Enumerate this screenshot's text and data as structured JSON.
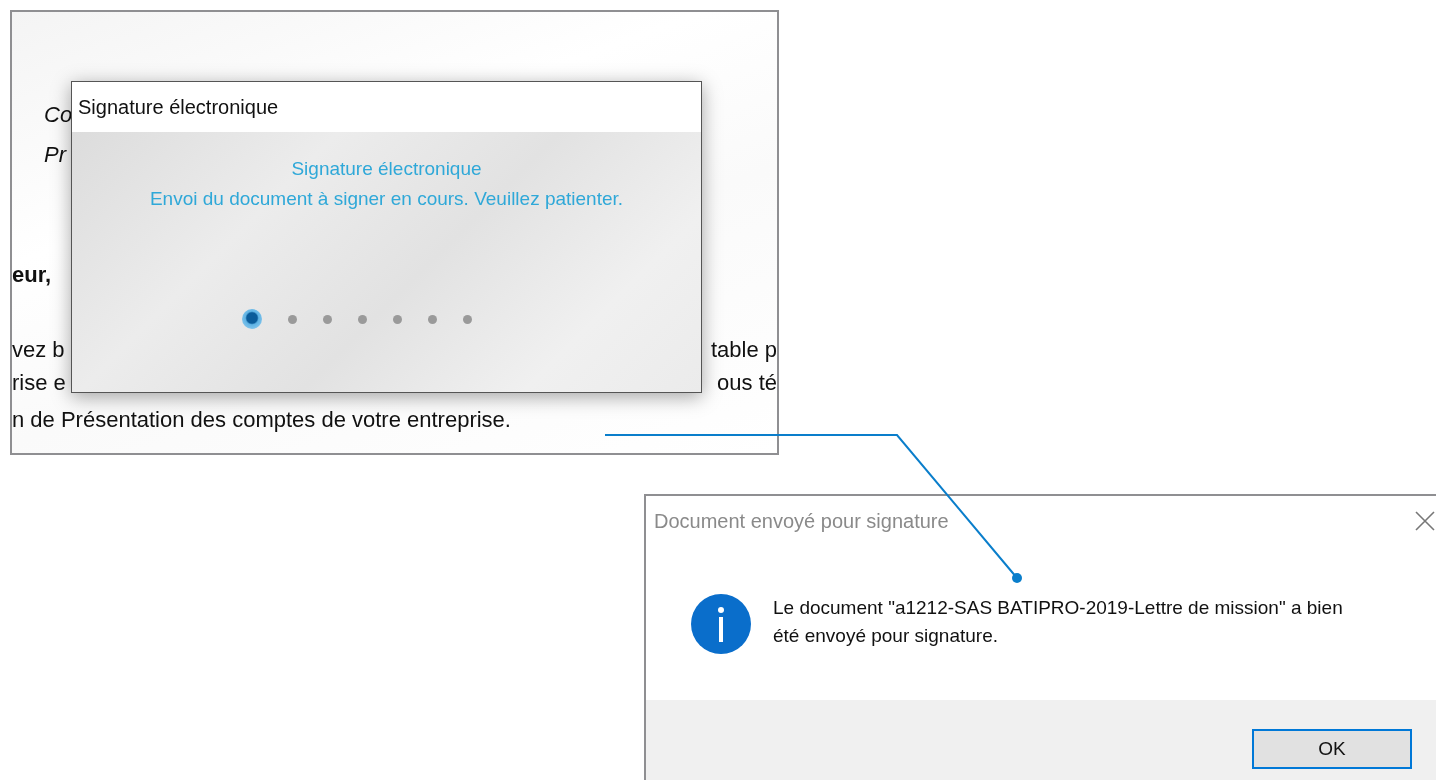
{
  "document": {
    "lines": [
      {
        "text": "Co",
        "kind": "italic"
      },
      {
        "text": "Pr",
        "kind": "italic"
      },
      {
        "text": "eur,",
        "kind": "bold"
      },
      {
        "text": "vez b",
        "kind": "plain",
        "right": "table p"
      },
      {
        "text": "rise e",
        "kind": "plain",
        "right": "ous té"
      },
      {
        "text": "n de Présentation des comptes de votre entreprise.",
        "kind": "plain"
      }
    ]
  },
  "progress_dialog": {
    "title": "Signature électronique",
    "heading": "Signature électronique",
    "message": "Envoi du document à signer en cours. Veuillez patienter.",
    "steps": [
      {
        "selected": true
      },
      {
        "selected": false
      },
      {
        "selected": false
      },
      {
        "selected": false
      },
      {
        "selected": false
      },
      {
        "selected": false
      },
      {
        "selected": false
      }
    ]
  },
  "message_dialog": {
    "title": "Document envoyé pour signature",
    "message": "Le document \"a1212-SAS BATIPRO-2019-Lettre de mission\" a bien été envoyé pour signature.",
    "buttons": [
      "OK"
    ]
  }
}
